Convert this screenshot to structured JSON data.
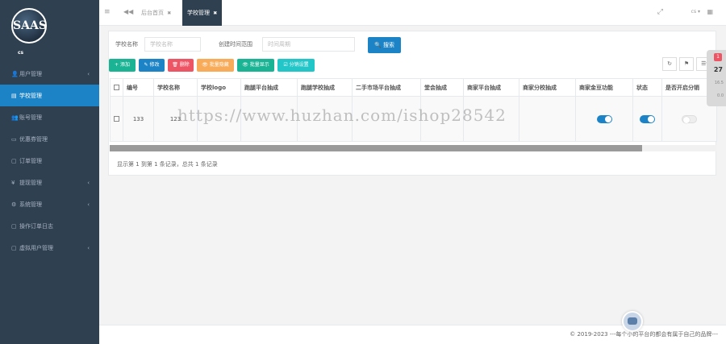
{
  "sidebar": {
    "logo_text": "SAAS",
    "user_name": "cs",
    "items": [
      {
        "label": "用户管理",
        "icon": "👤",
        "icon_name": "user-icon",
        "arrow": "‹"
      },
      {
        "label": "学校管理",
        "icon": "▤",
        "icon_name": "school-icon",
        "arrow": ""
      },
      {
        "label": "账号管理",
        "icon": "👥",
        "icon_name": "users-icon",
        "arrow": ""
      },
      {
        "label": "优惠券管理",
        "icon": "▭",
        "icon_name": "coupon-icon",
        "arrow": ""
      },
      {
        "label": "订单管理",
        "icon": "▢",
        "icon_name": "order-icon",
        "arrow": ""
      },
      {
        "label": "提现管理",
        "icon": "¥",
        "icon_name": "yen-icon",
        "arrow": "‹"
      },
      {
        "label": "系统管理",
        "icon": "⚙",
        "icon_name": "gear-icon",
        "arrow": "‹"
      },
      {
        "label": "操作订单日志",
        "icon": "▢",
        "icon_name": "log-icon",
        "arrow": ""
      },
      {
        "label": "虚拟用户管理",
        "icon": "▢",
        "icon_name": "virtual-user-icon",
        "arrow": "‹"
      }
    ]
  },
  "topbar": {
    "hamburger": "≡",
    "back": "◀◀",
    "tabs": [
      {
        "label": "后台首页",
        "close": "✖"
      },
      {
        "label": "学校管理",
        "close": "✖"
      }
    ],
    "fullscreen": "⤢",
    "user": "cs ▾",
    "grid": "▦"
  },
  "filters": {
    "school_label": "学校名称",
    "school_placeholder": "学校名称",
    "time_label": "创建时间范围",
    "time_placeholder": "时间周期",
    "search_label": "🔍 搜索"
  },
  "toolbar": {
    "add": "+ 添加",
    "edit": "✎ 修改",
    "delete": "🗑 删除",
    "batch_hide": "👁 批量隐藏",
    "batch_show": "👁 批量显示",
    "commission": "☑ 分销设置",
    "refresh": "↻",
    "columns_icon": "⚑",
    "list_icon": "☰▾"
  },
  "table": {
    "headers": [
      "编号",
      "学校名称",
      "学校logo",
      "跑腿平台抽成",
      "跑腿学校抽成",
      "二手市场平台抽成",
      "堂会抽成",
      "商家平台抽成",
      "商家分校抽成",
      "商家金豆功能",
      "状态",
      "是否开启分销"
    ],
    "rows": [
      {
        "id": "133",
        "name": "123",
        "logo": "",
        "c1": "",
        "c2": "",
        "c3": "",
        "c4": "",
        "c5": "",
        "c6": "",
        "gold": "on",
        "status": "on",
        "distribution": "off"
      }
    ],
    "pager": "显示第 1 到第 1 条记录，总共 1 条记录"
  },
  "side_widget": {
    "badge": "1",
    "number": "27",
    "sub1": "16.5",
    "sub2": "0.0"
  },
  "footer": {
    "text": "© 2019-2023 ---每个小的平台的都会有属于自己的品牌---"
  },
  "watermark": "https://www.huzhan.com/ishop28542",
  "colors": {
    "sidebar_bg": "#2f4050",
    "primary": "#1c84c6",
    "success": "#1ab394",
    "info": "#23c6c8",
    "danger": "#ed5565",
    "warning": "#f8ac59"
  }
}
